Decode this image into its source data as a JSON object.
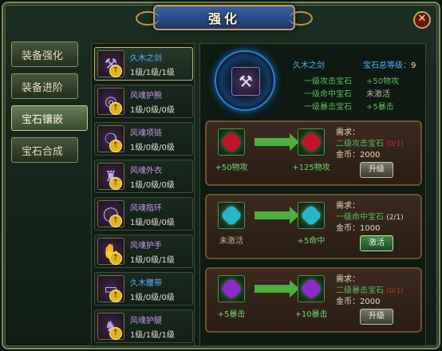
{
  "window": {
    "title": "强化",
    "close_label": "✕"
  },
  "tabs": [
    {
      "label": "装备强化",
      "active": false
    },
    {
      "label": "装备进阶",
      "active": false
    },
    {
      "label": "宝石镶嵌",
      "active": true
    },
    {
      "label": "宝石合成",
      "active": false
    }
  ],
  "items": [
    {
      "name": "久木之剑",
      "levels": "1级/1级/1级",
      "color": "blue",
      "icon": "⚒"
    },
    {
      "name": "风魂护腕",
      "levels": "1级/0级/0级",
      "color": "purple",
      "icon": "◎"
    },
    {
      "name": "风魂项链",
      "levels": "1级/0级/0级",
      "color": "purple",
      "icon": "❍"
    },
    {
      "name": "风魂外衣",
      "levels": "1级/0级/0级",
      "color": "purple",
      "icon": "♜"
    },
    {
      "name": "风魂指环",
      "levels": "1级/0级/0级",
      "color": "purple",
      "icon": "◯"
    },
    {
      "name": "风魂护手",
      "levels": "1级/0级/1级",
      "color": "purple",
      "icon": "✋"
    },
    {
      "name": "久木腰带",
      "levels": "1级/0级/0级",
      "color": "blue",
      "icon": "▭"
    },
    {
      "name": "风魂护腿",
      "levels": "1级/1级/1级",
      "color": "purple",
      "icon": "♞"
    }
  ],
  "summary": {
    "weapon_name": "久木之剑",
    "total_label": "宝石总等级：",
    "total_value": "9",
    "gems": [
      {
        "label": "一级攻击宝石",
        "value": "+50物攻",
        "color": "#5db860"
      },
      {
        "label": "一级命中宝石",
        "value": "未激活",
        "color": "#b6b09c"
      },
      {
        "label": "一级暴击宝石",
        "value": "+5暴击",
        "color": "#5db860"
      }
    ]
  },
  "cards": [
    {
      "from_caption": "+50物攻",
      "to_caption": "+125物攻",
      "gem_color": "#c0142a",
      "req_title": "需求：",
      "req_gem": "二级攻击宝石",
      "req_count": "(0/1)",
      "req_ok": false,
      "req_gold": "金币：2000",
      "button": "升级",
      "button_style": "grey",
      "from_grey": false
    },
    {
      "from_caption": "未激活",
      "to_caption": "+5命中",
      "gem_color": "#25b6c8",
      "req_title": "需求：",
      "req_gem": "一级命中宝石",
      "req_count": "(2/1)",
      "req_ok": true,
      "req_gold": "金币：1000",
      "button": "激活",
      "button_style": "green",
      "from_grey": true
    },
    {
      "from_caption": "+5暴击",
      "to_caption": "+10暴击",
      "gem_color": "#8a2ad0",
      "req_title": "需求：",
      "req_gem": "二级暴击宝石",
      "req_count": "(0/1)",
      "req_ok": false,
      "req_gold": "金币：2000",
      "button": "升级",
      "button_style": "grey",
      "from_grey": false
    }
  ]
}
